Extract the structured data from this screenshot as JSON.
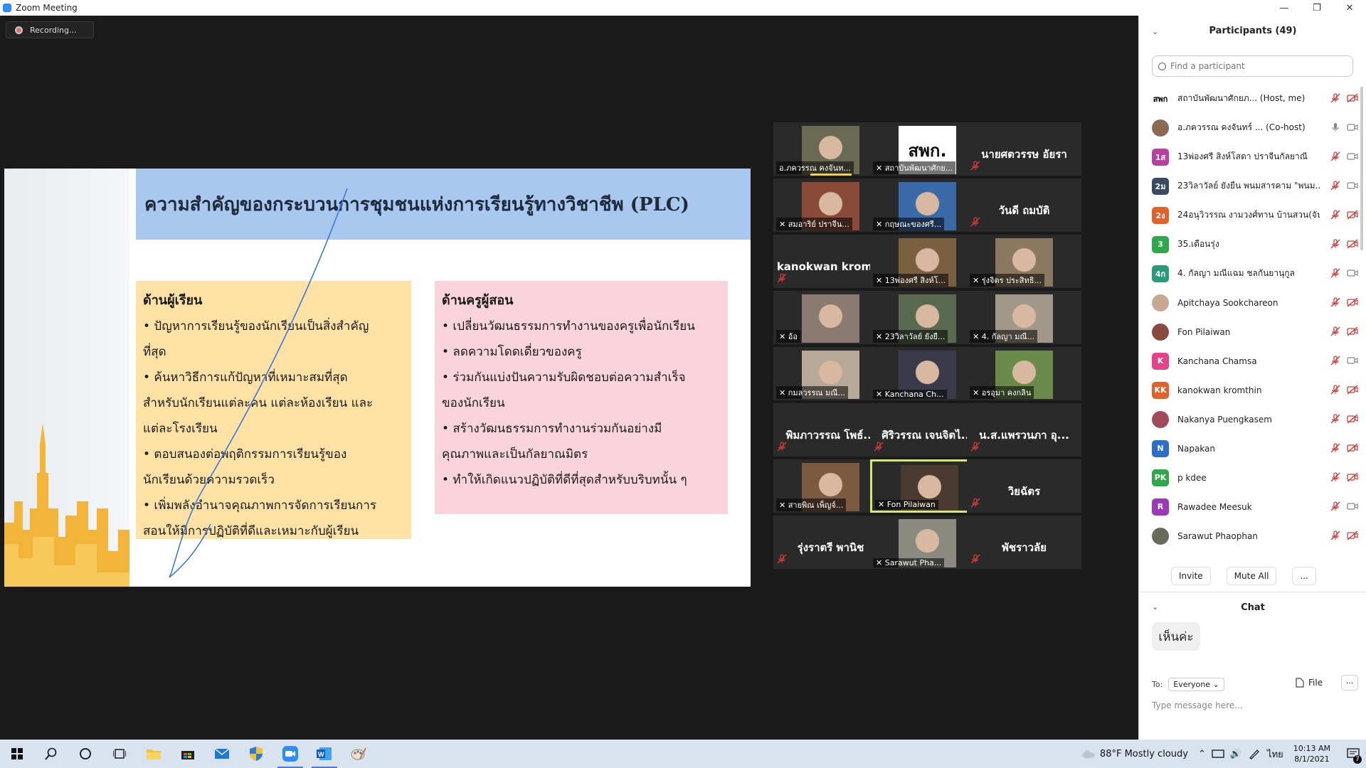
{
  "window": {
    "title": "Zoom Meeting",
    "controls": [
      "minimize",
      "restore",
      "close"
    ]
  },
  "recording": {
    "label": "Recording..."
  },
  "slide": {
    "title": "ความสำคัญของกระบวนการชุมชนแห่งการเรียนรู้ทางวิชาชีพ (PLC)",
    "left_box": {
      "heading": "ด้านผู้เรียน",
      "lines": [
        "• ปัญหาการเรียนรู้ของนักเรียนเป็นสิ่งสำคัญ",
        "ที่สุด",
        "• ค้นหาวิธีการแก้ปัญหาที่เหมาะสมที่สุด",
        "สำหรับนักเรียนแต่ละคน แต่ละห้องเรียน และ",
        "แต่ละโรงเรียน",
        "• ตอบสนองต่อพฤติกรรมการเรียนรู้ของ",
        "นักเรียนด้วยความรวดเร็ว",
        "• เพิ่มพลังอำนาจคุณภาพการจัดการเรียนการ",
        "สอนให้มีการปฏิบัติที่ดีและเหมาะกับผู้เรียน"
      ]
    },
    "right_box": {
      "heading": "ด้านครูผู้สอน",
      "lines": [
        "• เปลี่ยนวัฒนธรรมการทำงานของครูเพื่อนักเรียน",
        "• ลดความโดดเดี่ยวของครู",
        "• ร่วมกันแบ่งปันความรับผิดชอบต่อความสำเร็จ",
        "ของนักเรียน",
        "• สร้างวัฒนธรรมการทำงานร่วมกันอย่างมี",
        "คุณภาพและเป็นกัลยาณมิตร",
        "• ทำให้เกิดแนวปฏิบัติที่ดีที่สุดสำหรับบริบทนั้น ๆ"
      ]
    }
  },
  "video_tiles": [
    {
      "name": "อ.ภควรรณ คงจันท...",
      "type": "video",
      "color": "#6a6a52",
      "active_speaker_bar": true
    },
    {
      "name": "สถาบันพัฒนาศักย...",
      "type": "logo",
      "logo_text": "สพก.",
      "color": "#ffffff"
    },
    {
      "name": "นายศตวรรษ อัยรา",
      "type": "text"
    },
    {
      "name": "สมอาริย์ ปราจีน...",
      "type": "video",
      "color": "#8a4a3a"
    },
    {
      "name": "กฤษณะของศรี...",
      "type": "video",
      "color": "#3a6aa8"
    },
    {
      "name": "วันดี ถมบัติ",
      "type": "text"
    },
    {
      "name": "kanokwan krom...",
      "type": "text"
    },
    {
      "name": "13พ่องศรี สิงห์โ...",
      "type": "video",
      "color": "#7a6040"
    },
    {
      "name": "รุ่งจิตร ประสิทธิ...",
      "type": "video",
      "color": "#8a7860"
    },
    {
      "name": "อ้อ",
      "type": "video",
      "color": "#8a7a70"
    },
    {
      "name": "23วิลาวัลย์ ยังยื...",
      "type": "video",
      "color": "#5a6a50"
    },
    {
      "name": "4. กัลญา มณี...",
      "type": "video",
      "color": "#a09888"
    },
    {
      "name": "กมลวรรณ มณี...",
      "type": "video",
      "color": "#b8a898"
    },
    {
      "name": "Kanchana Ch...",
      "type": "video",
      "color": "#3a3a4a"
    },
    {
      "name": "อรอุมา คงกลิน",
      "type": "video",
      "color": "#6a8a4a"
    },
    {
      "name": "พิมภาวรรณ โพธ์...",
      "type": "text"
    },
    {
      "name": "ศิริวรรณ เจนจิตไ...",
      "type": "text"
    },
    {
      "name": "น.ส.แพรวนภา อุ...",
      "type": "text"
    },
    {
      "name": "สายพิณ เพ็ญจ์...",
      "type": "video",
      "color": "#7a5a40"
    },
    {
      "name": "Fon Pilaiwan",
      "type": "video",
      "color": "#4a3a30",
      "active": true
    },
    {
      "name": "วิยฉัตร",
      "type": "text"
    },
    {
      "name": "รุ่งราตรี พานิช",
      "type": "text"
    },
    {
      "name": "Sarawut Pha...",
      "type": "video",
      "color": "#8a8a80"
    },
    {
      "name": "พัชราวลัย",
      "type": "text"
    }
  ],
  "participants": {
    "title": "Participants (49)",
    "search_placeholder": "Find a participant",
    "list": [
      {
        "avatar": "สพก",
        "avatar_color": "#ffffff",
        "avatar_text_color": "#000000",
        "name": "สถาบันพัฒนาศักยภ... (Host, me)",
        "cam": "off",
        "mic": "muted"
      },
      {
        "avatar": "",
        "avatar_color": "#8a6a50",
        "name": "อ.ภควรรณ คงจันทร์ ... (Co-host)",
        "cam": "on",
        "mic": "on"
      },
      {
        "avatar": "1ส",
        "avatar_color": "#b840a0",
        "name": "13พ่องศรี สิงห์โสดา ปราจีนกัลยาณี",
        "cam": "on",
        "mic": "muted"
      },
      {
        "avatar": "2ม",
        "avatar_color": "#3a4a60",
        "name": "23วิลาวัลย์ ยังยืน พนมสารคาม \"พนม...",
        "cam": "on",
        "mic": "muted"
      },
      {
        "avatar": "2ง",
        "avatar_color": "#e0622a",
        "name": "24อนุวิวรรณ งามวงศ์ทาน บ้านสวน(จัน...",
        "cam": "off",
        "mic": "muted"
      },
      {
        "avatar": "3",
        "avatar_color": "#2ea84a",
        "name": "35.เดือนรุ่ง",
        "cam": "off",
        "mic": "muted"
      },
      {
        "avatar": "4ก",
        "avatar_color": "#2a9a7a",
        "name": "4. กัลญา มณีแฉม ชลกันยานุกูล",
        "cam": "on",
        "mic": "muted"
      },
      {
        "avatar": "",
        "avatar_color": "#c8a890",
        "name": "Apitchaya Sookchareon",
        "cam": "off",
        "mic": "muted"
      },
      {
        "avatar": "",
        "avatar_color": "#8a4a40",
        "name": "Fon Pilaiwan",
        "cam": "off",
        "mic": "muted"
      },
      {
        "avatar": "K",
        "avatar_color": "#e8418a",
        "name": "Kanchana Chamsa",
        "cam": "on",
        "mic": "muted"
      },
      {
        "avatar": "KK",
        "avatar_color": "#e0622a",
        "name": "kanokwan kromthin",
        "cam": "off",
        "mic": "muted"
      },
      {
        "avatar": "",
        "avatar_color": "#a04a5a",
        "name": "Nakanya Puengkasem",
        "cam": "off",
        "mic": "muted"
      },
      {
        "avatar": "N",
        "avatar_color": "#2d6ec8",
        "name": "Napakan",
        "cam": "off",
        "mic": "muted"
      },
      {
        "avatar": "PK",
        "avatar_color": "#2ea84a",
        "name": "p kdee",
        "cam": "off",
        "mic": "muted"
      },
      {
        "avatar": "R",
        "avatar_color": "#9a3ab8",
        "name": "Rawadee Meesuk",
        "cam": "on",
        "mic": "muted"
      },
      {
        "avatar": "",
        "avatar_color": "#6a6a5a",
        "name": "Sarawut Phaophan",
        "cam": "off",
        "mic": "muted"
      }
    ],
    "invite_label": "Invite",
    "mute_all_label": "Mute All",
    "more_label": "..."
  },
  "chat": {
    "title": "Chat",
    "message": "เห็นค่ะ",
    "to_label": "To:",
    "recipient": "Everyone",
    "file_label": "File",
    "more_label": "···",
    "input_placeholder": "Type message here..."
  },
  "taskbar": {
    "weather": "88°F  Mostly cloudy",
    "language": "ไทย",
    "time": "10:13 AM",
    "date": "8/1/2021",
    "notifications": "7"
  },
  "colors": {
    "slide_header": "#a9c8f0",
    "box_left": "#fde1a5",
    "box_right": "#fad4dd",
    "muted_red": "#d23a3a",
    "zoom_blue": "#2d8cff"
  }
}
